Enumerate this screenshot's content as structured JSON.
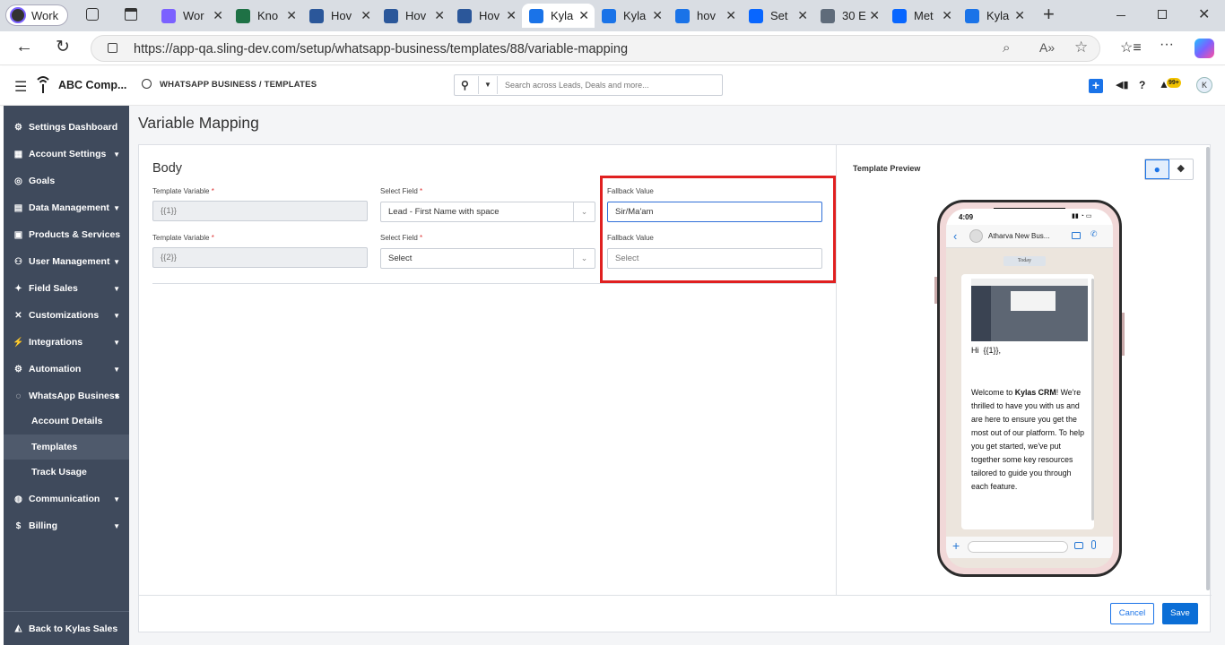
{
  "browser": {
    "profile_label": "Work",
    "tabs": [
      {
        "label": "Wor",
        "icon": "copilot-icon",
        "color": "#7b61ff"
      },
      {
        "label": "Kno",
        "icon": "excel-icon",
        "color": "#1e7145"
      },
      {
        "label": "Hov",
        "icon": "word-icon",
        "color": "#2b579a"
      },
      {
        "label": "Hov",
        "icon": "word-icon",
        "color": "#2b579a"
      },
      {
        "label": "Hov",
        "icon": "word-icon",
        "color": "#2b579a"
      },
      {
        "label": "Kyla",
        "icon": "kylas-icon",
        "color": "#1a73e8"
      },
      {
        "label": "Kyla",
        "icon": "kylas-icon",
        "color": "#1a73e8"
      },
      {
        "label": "hov",
        "icon": "search-icon",
        "color": "#1a73e8"
      },
      {
        "label": "Set",
        "icon": "meta-icon",
        "color": "#0866ff"
      },
      {
        "label": "30 E",
        "icon": "s-icon",
        "color": "#5f6b7a"
      },
      {
        "label": "Met",
        "icon": "meta-icon",
        "color": "#0866ff"
      },
      {
        "label": "Kyla",
        "icon": "kylas-icon",
        "color": "#1a73e8"
      }
    ],
    "new_tab": "+",
    "url": "https://app-qa.sling-dev.com/setup/whatsapp-business/templates/88/variable-mapping"
  },
  "header": {
    "company": "ABC Comp...",
    "breadcrumb": "WHATSAPP BUSINESS / TEMPLATES",
    "search_placeholder": "Search across Leads, Deals and more...",
    "notifications_badge": "99+",
    "avatar_initial": "K"
  },
  "sidebar": {
    "items": [
      {
        "label": "Settings Dashboard",
        "icon": "gear-icon",
        "caret": false
      },
      {
        "label": "Account Settings",
        "icon": "building-icon",
        "caret": true
      },
      {
        "label": "Goals",
        "icon": "target-icon",
        "caret": false
      },
      {
        "label": "Data Management",
        "icon": "table-icon",
        "caret": true
      },
      {
        "label": "Products & Services",
        "icon": "box-icon",
        "caret": false
      },
      {
        "label": "User Management",
        "icon": "users-icon",
        "caret": true
      },
      {
        "label": "Field Sales",
        "icon": "walk-icon",
        "caret": true
      },
      {
        "label": "Customizations",
        "icon": "tools-icon",
        "caret": true
      },
      {
        "label": "Integrations",
        "icon": "plug-icon",
        "caret": true
      },
      {
        "label": "Automation",
        "icon": "cogs-icon",
        "caret": true
      },
      {
        "label": "WhatsApp Business",
        "icon": "whatsapp-icon",
        "caret": true
      }
    ],
    "subitems": [
      "Account Details",
      "Templates",
      "Track Usage"
    ],
    "bottom_items": [
      {
        "label": "Communication",
        "icon": "chat-icon",
        "caret": true
      },
      {
        "label": "Billing",
        "icon": "dollar-icon",
        "caret": true
      }
    ],
    "back_label": "Back to Kylas Sales"
  },
  "page": {
    "title": "Variable Mapping",
    "section": "Body",
    "rows": [
      {
        "var_label": "Template Variable",
        "var_value": "{{1}}",
        "field_label": "Select Field",
        "field_value": "Lead - First Name with space",
        "fallback_label": "Fallback Value",
        "fallback_value": "Sir/Ma'am",
        "fallback_placeholder": ""
      },
      {
        "var_label": "Template Variable",
        "var_value": "{{2}}",
        "field_label": "Select Field",
        "field_value": "Select",
        "fallback_label": "Fallback Value",
        "fallback_value": "",
        "fallback_placeholder": "Select"
      }
    ],
    "required_mark": "*",
    "cancel_label": "Cancel",
    "save_label": "Save"
  },
  "preview": {
    "title": "Template Preview",
    "time": "4:09",
    "contact": "Atharva New Bus...",
    "date_chip": "Today",
    "greeting": "Hi  {{1}},",
    "body_pre": "Welcome to ",
    "body_bold": "Kylas CRM",
    "body_post": "! We're thrilled to have you with us and are here to ensure you get the most out of our platform. To help you get started, we've put together some key resources tailored to guide you through each feature."
  },
  "colors": {
    "sidebar_bg": "#3f4a5c",
    "accent": "#0b6ed6",
    "highlight_box": "#e02020"
  }
}
